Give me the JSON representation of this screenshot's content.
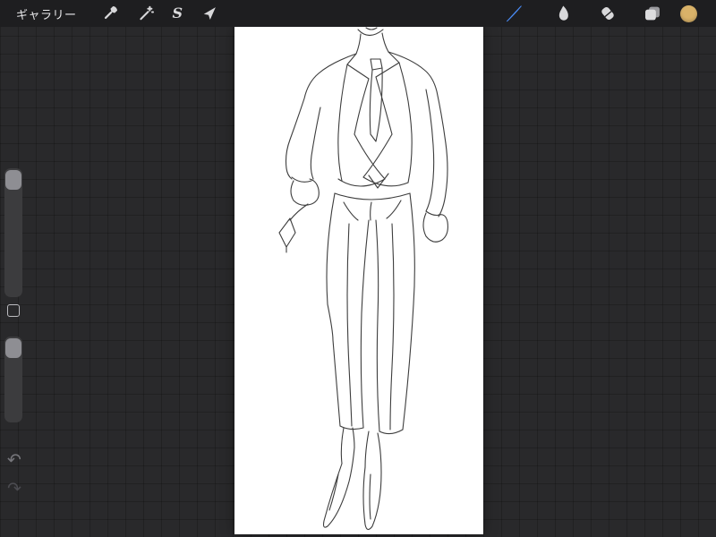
{
  "colors": {
    "accent": "#4a8cf7",
    "swatch": "#d9b269",
    "icon": "#d8d8da",
    "topbar_bg": "#1e1e20",
    "canvas_bg": "#ffffff",
    "workspace_bg": "#29292b",
    "sketch_stroke": "#3d3d3d"
  },
  "topbar": {
    "gallery_label": "ギャラリー",
    "left_tools": [
      {
        "id": "actions",
        "label": "Actions"
      },
      {
        "id": "adjustments",
        "label": "Adjustments"
      },
      {
        "id": "selection",
        "label": "Selection",
        "glyph": "S"
      },
      {
        "id": "transform",
        "label": "Transform"
      }
    ],
    "right_tools": [
      {
        "id": "paint",
        "label": "Paint",
        "active": true
      },
      {
        "id": "smudge",
        "label": "Smudge"
      },
      {
        "id": "erase",
        "label": "Erase"
      },
      {
        "id": "layers",
        "label": "Layers"
      },
      {
        "id": "color",
        "label": "Color"
      }
    ]
  },
  "sidebar": {
    "sliders": [
      {
        "id": "brush-size"
      },
      {
        "id": "opacity"
      }
    ],
    "modify_button": {
      "id": "modify"
    },
    "history": {
      "undo": "↶",
      "redo": "↷"
    }
  },
  "canvas": {
    "description": "pencil line sketch of a standing figure wearing a suit jacket, tie and slim trousers, head cropped at top, feet pointed"
  }
}
